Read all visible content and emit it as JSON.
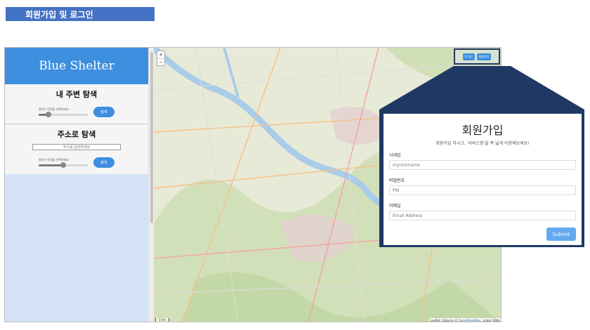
{
  "slide_title": "회원가입 및 로그인",
  "sidebar": {
    "brand": "Blue Shelter",
    "nearby": {
      "heading": "내 주변 탐색",
      "radius_label": "원하는 반경을 선택하세요",
      "radius_level": 0.2,
      "button": "탐색"
    },
    "address": {
      "heading": "주소로 탐색",
      "input_placeholder": "주소를 입력하세요",
      "radius_label": "원하는 반경을 선택하세요",
      "radius_level": 0.5,
      "button": "탐색"
    }
  },
  "map": {
    "zoom_in": "+",
    "zoom_out": "−",
    "scale": "3 km",
    "attribution_prefix": "Leaflet | Data by ©",
    "attribution_link": "OpenStreetMap",
    "attribution_suffix": ", under ODbL."
  },
  "header_buttons": {
    "login": "로그인",
    "signup": "회원가입"
  },
  "signup_modal": {
    "title": "회원가입",
    "subtitle": "회원가입 하시고, '서비스명'을 폭 넓게 이용해보세요!",
    "nickname_label": "닉네임",
    "nickname_placeholder": "mynickname",
    "password_label": "비밀번호",
    "password_placeholder": "PW",
    "email_label": "이메일",
    "email_placeholder": "Email Address",
    "submit": "Submit"
  },
  "colors": {
    "accent": "#3e8fe0",
    "callout": "#203864",
    "title_bar": "#4472c4",
    "water": "#a9cde9"
  }
}
